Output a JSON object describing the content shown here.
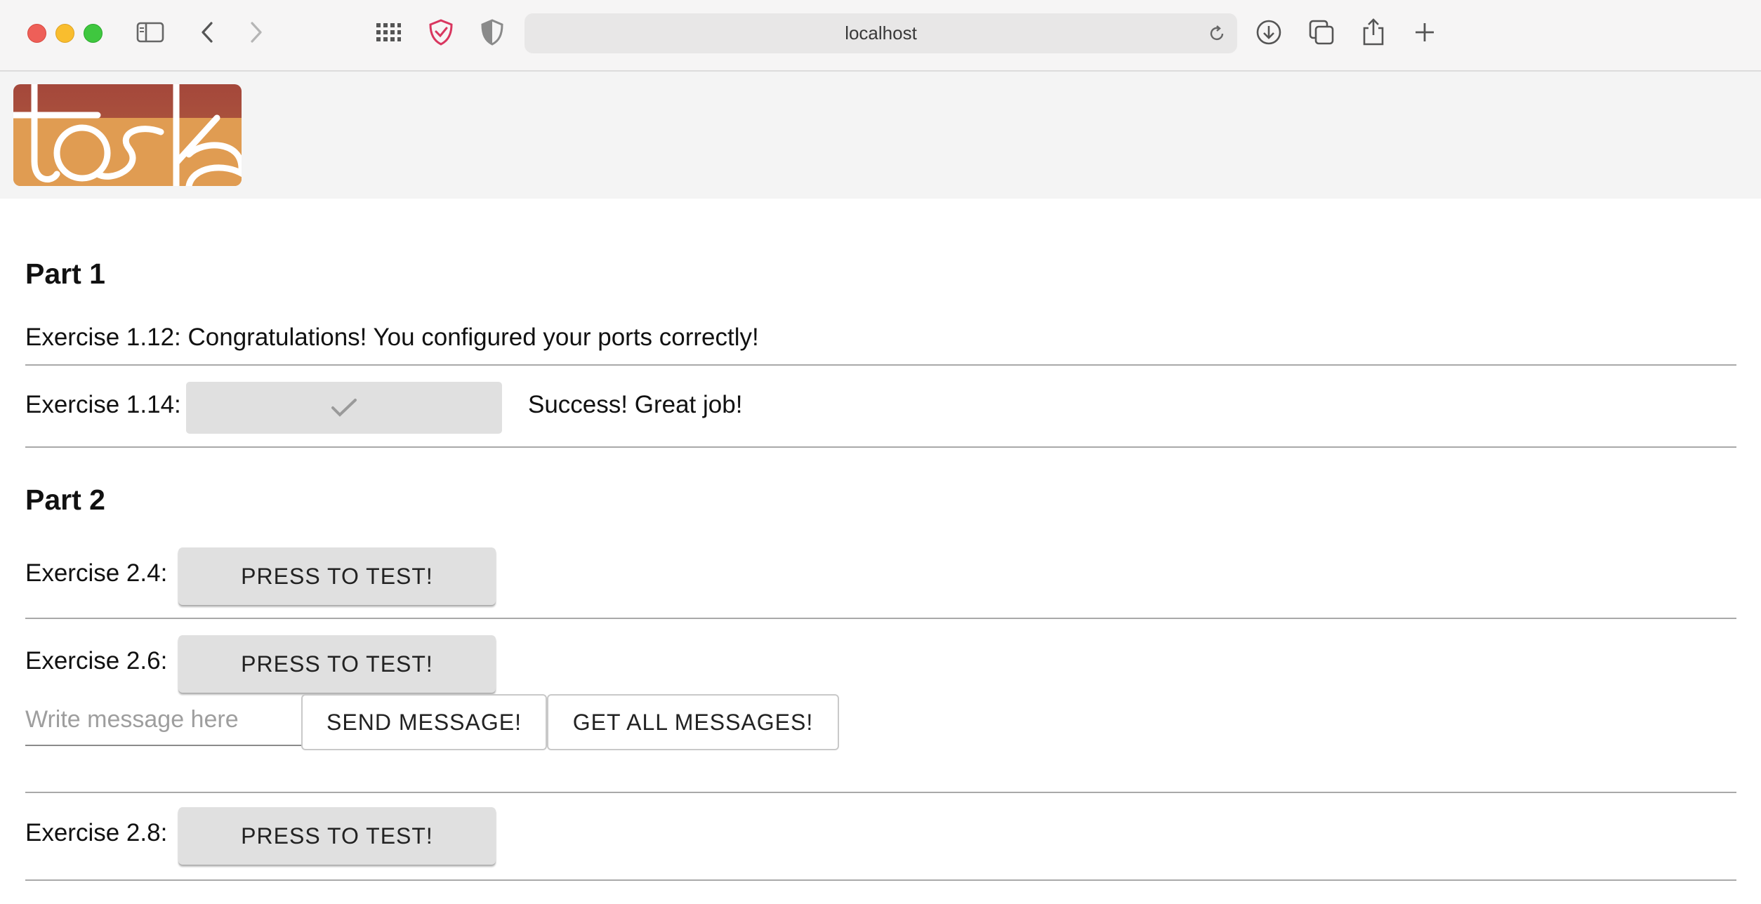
{
  "browser": {
    "url": "localhost",
    "icons": [
      "sidebar-icon",
      "back-icon",
      "forward-icon",
      "grid-icon",
      "privacy-shield-icon",
      "shield-icon",
      "reload-icon",
      "download-icon",
      "tabs-icon",
      "share-icon",
      "new-tab-icon"
    ]
  },
  "header": {
    "logo_text": "toska",
    "colors": {
      "logo_top": "#a4473b",
      "logo_bottom": "#e3a153"
    }
  },
  "part1": {
    "title": "Part 1",
    "ex112": "Exercise 1.12: Congratulations! You configured your ports correctly!",
    "ex114_label": "Exercise 1.14:",
    "ex114_status": "Success! Great job!",
    "ex114_icon": "checkmark-icon"
  },
  "part2": {
    "title": "Part 2",
    "ex24_label": "Exercise 2.4:",
    "ex24_button": "PRESS TO TEST!",
    "ex26_label": "Exercise 2.6:",
    "ex26_button": "PRESS TO TEST!",
    "message_placeholder": "Write message here",
    "send_button": "SEND MESSAGE!",
    "get_button": "GET ALL MESSAGES!",
    "ex28_label": "Exercise 2.8:",
    "ex28_button": "PRESS TO TEST!"
  }
}
